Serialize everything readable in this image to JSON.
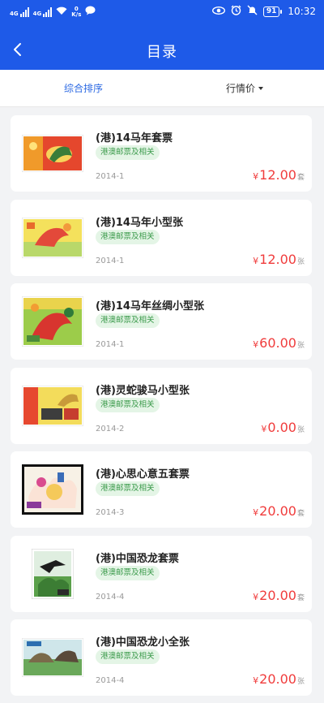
{
  "status_bar": {
    "time": "10:32",
    "battery": "91",
    "net_speed_value": "0",
    "net_speed_unit": "K/s",
    "signal1_label": "4G",
    "signal2_label": "4G",
    "icons": [
      "signal-icon",
      "wifi-icon",
      "message-icon",
      "eye-icon",
      "alarm-icon",
      "mute-icon",
      "battery-icon"
    ]
  },
  "header": {
    "title": "目录"
  },
  "sort": {
    "primary": "综合排序",
    "secondary": "行情价"
  },
  "colors": {
    "brand": "#1e5ae8",
    "price": "#f03c3c",
    "tag_text": "#3b9a4b",
    "tag_bg": "#e4f5e6",
    "active_sort": "#2d6ae3"
  },
  "items": [
    {
      "title": "(港)14马年套票",
      "tag": "港澳邮票及相关",
      "date": "2014-1",
      "currency": "¥",
      "price": "12.00",
      "unit": "套"
    },
    {
      "title": "(港)14马年小型张",
      "tag": "港澳邮票及相关",
      "date": "2014-1",
      "currency": "¥",
      "price": "12.00",
      "unit": "张"
    },
    {
      "title": "(港)14马年丝绸小型张",
      "tag": "港澳邮票及相关",
      "date": "2014-1",
      "currency": "¥",
      "price": "60.00",
      "unit": "张"
    },
    {
      "title": "(港)灵蛇骏马小型张",
      "tag": "港澳邮票及相关",
      "date": "2014-2",
      "currency": "¥",
      "price": "0.00",
      "unit": "张"
    },
    {
      "title": "(港)心思心意五套票",
      "tag": "港澳邮票及相关",
      "date": "2014-3",
      "currency": "¥",
      "price": "20.00",
      "unit": "套"
    },
    {
      "title": "(港)中国恐龙套票",
      "tag": "港澳邮票及相关",
      "date": "2014-4",
      "currency": "¥",
      "price": "20.00",
      "unit": "套"
    },
    {
      "title": "(港)中国恐龙小全张",
      "tag": "港澳邮票及相关",
      "date": "2014-4",
      "currency": "¥",
      "price": "20.00",
      "unit": "张"
    }
  ]
}
